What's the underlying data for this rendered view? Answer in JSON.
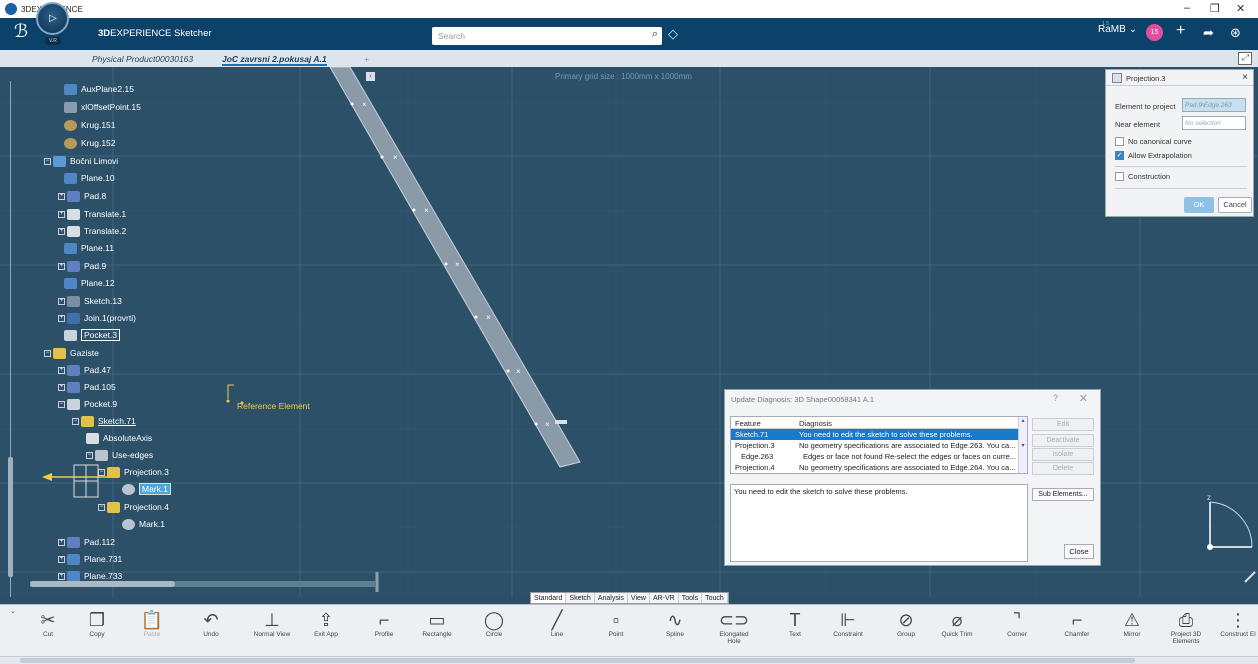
{
  "window": {
    "title": "3DEXPERIENCE",
    "controls": [
      "–",
      "❐",
      "✕"
    ]
  },
  "topbar": {
    "brand_bold": "3D",
    "brand_rest": "EXPERIENCE Sketcher",
    "compass_version": "V.R",
    "search_placeholder": "Search",
    "user": "RaMB",
    "user_counter": "1 5",
    "notification_count": "15"
  },
  "tabs": {
    "items": [
      "Physical Product00030163",
      "JoC zavrsni 2.pokusaj A.1"
    ],
    "add": "+"
  },
  "canvas": {
    "grid_label": "Primary grid size : 1000mm x 1000mm",
    "reference_element": "Reference Element"
  },
  "tree": {
    "nodes": [
      {
        "label": "AuxPlane2.15",
        "icon": "plane-icon",
        "color": "#4f86c6"
      },
      {
        "label": "xlOffsetPoint.15",
        "icon": "point-icon",
        "color": "#8a9bb0"
      },
      {
        "label": "Krug.151",
        "icon": "circle-icon",
        "color": "#b59a5a"
      },
      {
        "label": "Krug.152",
        "icon": "circle-icon",
        "color": "#b59a5a"
      },
      {
        "label": "Bočni Limovi",
        "icon": "geoset-icon",
        "color": "#5b9bd5"
      },
      {
        "label": "Plane.10",
        "icon": "plane-icon",
        "color": "#4f86c6"
      },
      {
        "label": "Pad.8",
        "icon": "pad-icon",
        "color": "#5f7fbf"
      },
      {
        "label": "Translate.1",
        "icon": "translate-icon",
        "color": "#d9dee4"
      },
      {
        "label": "Translate.2",
        "icon": "translate-icon",
        "color": "#d9dee4"
      },
      {
        "label": "Plane.11",
        "icon": "plane-icon",
        "color": "#4f86c6"
      },
      {
        "label": "Pad.9",
        "icon": "pad-icon",
        "color": "#5f7fbf"
      },
      {
        "label": "Plane.12",
        "icon": "plane-icon",
        "color": "#4f86c6"
      },
      {
        "label": "Sketch.13",
        "icon": "sketch-icon",
        "color": "#7b8ea3"
      },
      {
        "label": "Join.1(provrti)",
        "icon": "join-icon",
        "color": "#3f6fa8"
      },
      {
        "label": "Pocket.3",
        "icon": "pocket-icon",
        "color": "#c9d3dd"
      },
      {
        "label": "Gaziste",
        "icon": "geoset-icon",
        "color": "#e3c04a"
      },
      {
        "label": "Pad.47",
        "icon": "pad-icon",
        "color": "#5f7fbf"
      },
      {
        "label": "Pad.105",
        "icon": "pad-icon",
        "color": "#5f7fbf"
      },
      {
        "label": "Pocket.9",
        "icon": "pocket-icon",
        "color": "#c9d3dd"
      },
      {
        "label": "Sketch.71",
        "icon": "sketch-icon",
        "color": "#e3c04a"
      },
      {
        "label": "AbsoluteAxis",
        "icon": "axis-icon",
        "color": "#d9dee4"
      },
      {
        "label": "Use-edges",
        "icon": "use-edges-icon",
        "color": "#b9c4d0"
      },
      {
        "label": "Projection.3",
        "icon": "projection-icon",
        "color": "#e3c04a"
      },
      {
        "label": "Mark.1",
        "icon": "mark-icon",
        "color": "#b9c4d0"
      },
      {
        "label": "Projection.4",
        "icon": "projection-icon",
        "color": "#e3c04a"
      },
      {
        "label": "Mark.1",
        "icon": "mark-icon",
        "color": "#b9c4d0"
      },
      {
        "label": "Pad.112",
        "icon": "pad-icon",
        "color": "#5f7fbf"
      },
      {
        "label": "Plane.731",
        "icon": "plane-icon",
        "color": "#4f86c6"
      },
      {
        "label": "Plane.733",
        "icon": "plane-icon",
        "color": "#4f86c6"
      }
    ]
  },
  "projection_panel": {
    "title": "Projection.3",
    "element_to_project_label": "Element to project",
    "element_to_project_value": "Pad.9\\Edge.263",
    "near_element_label": "Near element",
    "near_element_value": "No selection",
    "no_canonical_curve": "No canonical curve",
    "allow_extrapolation": "Allow Extrapolation",
    "construction": "Construction",
    "ok": "OK",
    "cancel": "Cancel"
  },
  "update_dialog": {
    "title": "Update Diagnosis: 3D Shape00058341 A.1",
    "help": "?",
    "close_x": "✕",
    "col_feature": "Feature",
    "col_diagnosis": "Diagnosis",
    "rows": [
      {
        "feature": "Sketch.71",
        "diagnosis": "You need to edit the sketch to solve these problems."
      },
      {
        "feature": "Projection.3",
        "diagnosis": "No geometry specifications are associated to Edge.263. You ca..."
      },
      {
        "feature": "Edge.263",
        "diagnosis": "Edges or face not found Re-select the edges or faces on curre..."
      },
      {
        "feature": "Projection.4",
        "diagnosis": "No geometry specifications are associated to Edge.264. You ca..."
      }
    ],
    "message": "You need to edit the sketch to solve these problems.",
    "buttons": [
      "Edit",
      "Deactivate",
      "Isolate",
      "Delete"
    ],
    "sub_elements": "Sub Elements...",
    "close": "Close"
  },
  "category_tabs": [
    "Standard",
    "Sketch",
    "Analysis",
    "View",
    "AR-VR",
    "Tools",
    "Touch"
  ],
  "toolbar": {
    "tools": [
      {
        "label": "Cut",
        "icon": "scissors-icon",
        "glyph": "✂"
      },
      {
        "label": "Copy",
        "icon": "copy-icon",
        "glyph": "❐"
      },
      {
        "label": "Paste",
        "icon": "paste-icon",
        "glyph": "📋"
      },
      {
        "label": "Undo",
        "icon": "undo-icon",
        "glyph": "↶"
      },
      {
        "label": "Normal View",
        "icon": "normal-view-icon",
        "glyph": "⊥"
      },
      {
        "label": "Exit App",
        "icon": "exit-app-icon",
        "glyph": "⇪"
      },
      {
        "label": "Profile",
        "icon": "profile-icon",
        "glyph": "⌐"
      },
      {
        "label": "Rectangle",
        "icon": "rectangle-icon",
        "glyph": "▭"
      },
      {
        "label": "Circle",
        "icon": "circle-icon",
        "glyph": "◯"
      },
      {
        "label": "Line",
        "icon": "line-icon",
        "glyph": "╱"
      },
      {
        "label": "Point",
        "icon": "point-icon",
        "glyph": "▫"
      },
      {
        "label": "Spline",
        "icon": "spline-icon",
        "glyph": "∿"
      },
      {
        "label": "Elongated Hole",
        "icon": "elongated-hole-icon",
        "glyph": "⊂⊃"
      },
      {
        "label": "Text",
        "icon": "text-icon",
        "glyph": "T"
      },
      {
        "label": "Constraint",
        "icon": "constraint-icon",
        "glyph": "⊩"
      },
      {
        "label": "Group",
        "icon": "group-icon",
        "glyph": "⊘"
      },
      {
        "label": "Quick Trim",
        "icon": "quick-trim-icon",
        "glyph": "⌀"
      },
      {
        "label": "Corner",
        "icon": "corner-icon",
        "glyph": "⌝"
      },
      {
        "label": "Chamfer",
        "icon": "chamfer-icon",
        "glyph": "⌐"
      },
      {
        "label": "Mirror",
        "icon": "mirror-icon",
        "glyph": "⚠"
      },
      {
        "label": "Project 3D Elements",
        "icon": "project-3d-elements-icon",
        "glyph": "⎙"
      },
      {
        "label": "Construct El",
        "icon": "construct-icon",
        "glyph": "⋮"
      }
    ]
  }
}
